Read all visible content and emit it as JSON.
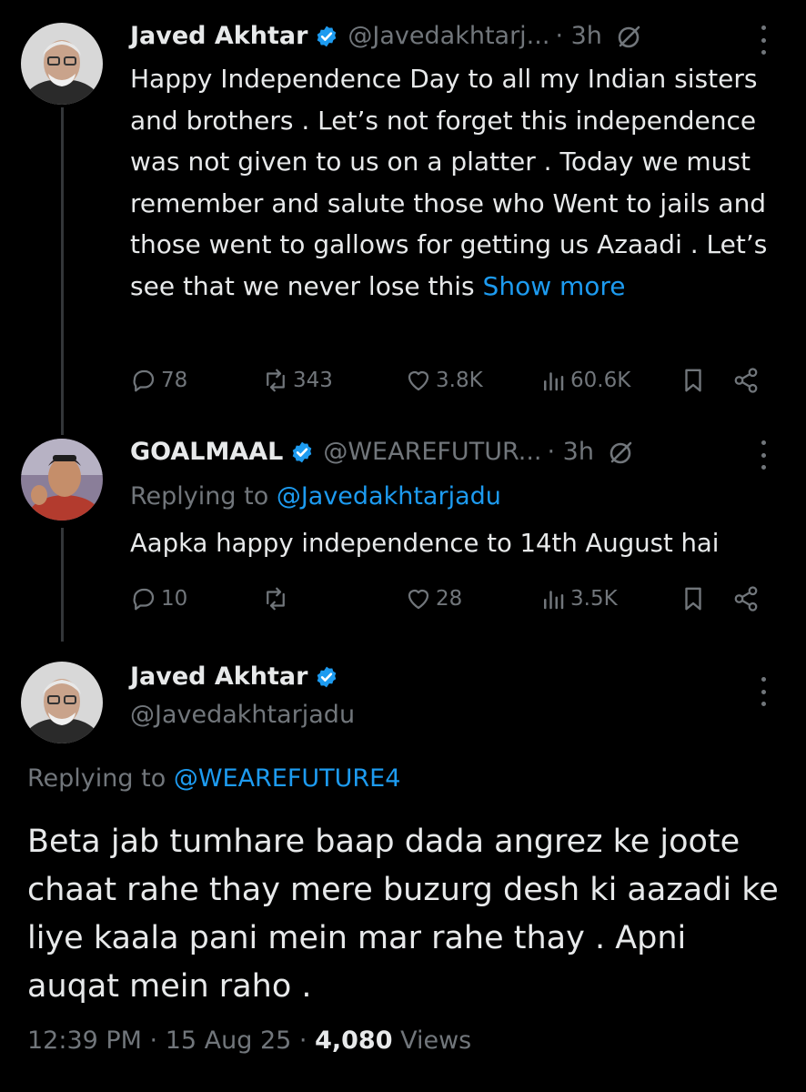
{
  "tweet1": {
    "name": "Javed Akhtar",
    "handle": "@Javedakhtarj...",
    "time": "· 3h",
    "text": "Happy Independence Day  to all my Indian sisters and brothers  . Let’s not forget this independence was not given to us on a platter . Today we must remember and salute those who Went to jails and those went to gallows for getting us Azaadi . Let’s see that we never lose this",
    "show_more": "Show more",
    "replies": "78",
    "reposts": "343",
    "likes": "3.8K",
    "views": "60.6K"
  },
  "tweet2": {
    "name": "GOALMAAL",
    "handle": "@WEAREFUTUR...",
    "time": "· 3h",
    "replying_prefix": "Replying to",
    "replying_to": "@Javedakhtarjadu",
    "text": "Aapka happy independence to 14th August hai",
    "replies": "10",
    "likes": "28",
    "views": "3.5K"
  },
  "main_tweet": {
    "name": "Javed Akhtar",
    "handle": "@Javedakhtarjadu",
    "replying_prefix": "Replying to",
    "replying_to": "@WEAREFUTURE4",
    "text": "Beta jab tumhare baap dada angrez ke joote chaat rahe thay mere buzurg desh ki aazadi ke liye kaala pani mein mar rahe thay . Apni auqat mein raho .",
    "timestamp": "12:39 PM · 15 Aug 25 ·",
    "view_count": "4,080",
    "views_label": "Views"
  },
  "colors": {
    "background": "#000000",
    "text": "#e7e9ea",
    "muted": "#71767b",
    "link": "#1d9bf0",
    "verified": "#1d9bf0"
  },
  "icons": [
    "verified-badge-icon",
    "grok-icon",
    "more-icon",
    "reply-icon",
    "repost-icon",
    "like-icon",
    "views-icon",
    "bookmark-icon",
    "share-icon"
  ]
}
